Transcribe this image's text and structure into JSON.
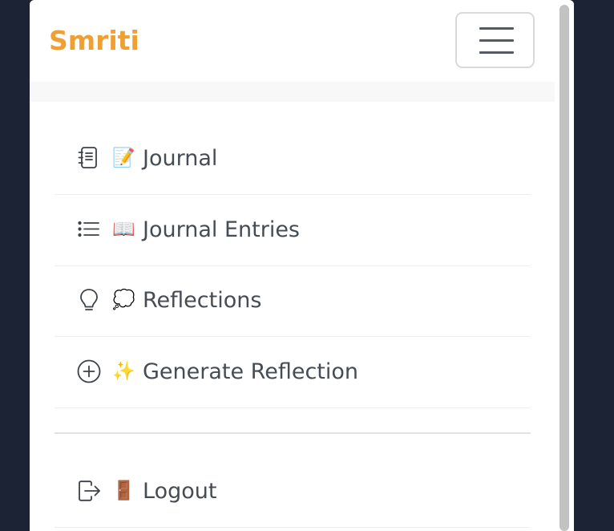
{
  "brand": {
    "name": "Smriti",
    "color": "#f0a032"
  },
  "toggler": {
    "icon": "hamburger-menu-icon"
  },
  "menu": {
    "items": [
      {
        "icon": "journal-notebook-icon",
        "emoji": "📝",
        "label": "Journal"
      },
      {
        "icon": "list-icon",
        "emoji": "📖",
        "label": "Journal Entries"
      },
      {
        "icon": "lightbulb-icon",
        "emoji": "💭",
        "label": "Reflections"
      },
      {
        "icon": "plus-circle-icon",
        "emoji": "✨",
        "label": "Generate Reflection"
      }
    ],
    "logout": {
      "icon": "box-arrow-right-icon",
      "emoji": "🚪",
      "label": "Logout"
    }
  },
  "colors": {
    "page_background": "#1c2335",
    "text": "#464c54",
    "icon": "#555b61"
  }
}
